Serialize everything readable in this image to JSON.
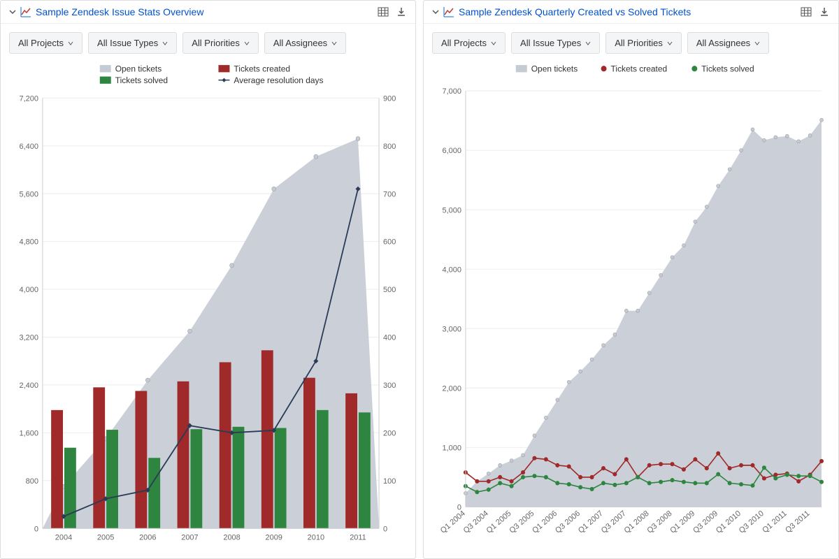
{
  "panels": {
    "left": {
      "title": "Sample Zendesk Issue Stats Overview",
      "filters": [
        "All Projects",
        "All Issue Types",
        "All Priorities",
        "All Assignees"
      ],
      "legend": {
        "open": "Open tickets",
        "created": "Tickets created",
        "solved": "Tickets solved",
        "avg": "Average resolution days"
      }
    },
    "right": {
      "title": "Sample Zendesk Quarterly Created vs Solved Tickets",
      "filters": [
        "All Projects",
        "All Issue Types",
        "All Priorities",
        "All Assignees"
      ],
      "legend": {
        "open": "Open tickets",
        "created": "Tickets created",
        "solved": "Tickets solved"
      }
    }
  },
  "colors": {
    "open_area": "#c5cbd4",
    "created_bar": "#a02929",
    "solved_bar": "#2e8540",
    "avg_line": "#2a3b57",
    "grid": "#eeeeee",
    "axis": "#cccccc",
    "text": "#555555",
    "title": "#0052cc"
  },
  "chart_data": [
    {
      "id": "annual_overview",
      "type": "combo",
      "title": "Sample Zendesk Issue Stats Overview",
      "categories": [
        "2004",
        "2005",
        "2006",
        "2007",
        "2008",
        "2009",
        "2010",
        "2011"
      ],
      "y_left": {
        "label": "",
        "min": 0,
        "max": 7200,
        "ticks": [
          0,
          800,
          1600,
          2400,
          3200,
          4000,
          4800,
          5600,
          6400,
          7200
        ]
      },
      "y_right": {
        "label": "",
        "min": 0,
        "max": 900,
        "ticks": [
          0,
          100,
          200,
          300,
          400,
          500,
          600,
          700,
          800,
          900
        ]
      },
      "series": [
        {
          "name": "Open tickets",
          "kind": "area",
          "axis": "left",
          "color": "#c5cbd4",
          "values": [
            700,
            1500,
            2480,
            3300,
            4400,
            5680,
            6220,
            6520
          ]
        },
        {
          "name": "Tickets created",
          "kind": "bar",
          "axis": "left",
          "color": "#a02929",
          "values": [
            1980,
            2360,
            2300,
            2460,
            2780,
            2980,
            2520,
            2260
          ]
        },
        {
          "name": "Tickets solved",
          "kind": "bar",
          "axis": "left",
          "color": "#2e8540",
          "values": [
            1350,
            1650,
            1180,
            1660,
            1700,
            1680,
            1980,
            1940
          ]
        },
        {
          "name": "Average resolution days",
          "kind": "line",
          "axis": "right",
          "color": "#2a3b57",
          "values": [
            25,
            62,
            80,
            215,
            200,
            205,
            350,
            710
          ]
        }
      ]
    },
    {
      "id": "quarterly",
      "type": "area_line",
      "title": "Sample Zendesk Quarterly Created vs Solved Tickets",
      "x_tick_labels": [
        "Q1 2004",
        "Q3 2004",
        "Q1 2005",
        "Q3 2005",
        "Q1 2006",
        "Q3 2006",
        "Q1 2007",
        "Q3 2007",
        "Q1 2008",
        "Q3 2008",
        "Q1 2009",
        "Q3 2009",
        "Q1 2010",
        "Q3 2010",
        "Q1 2011",
        "Q3 2011"
      ],
      "categories": [
        "Q1 2004",
        "Q2 2004",
        "Q3 2004",
        "Q4 2004",
        "Q1 2005",
        "Q2 2005",
        "Q3 2005",
        "Q4 2005",
        "Q1 2006",
        "Q2 2006",
        "Q3 2006",
        "Q4 2006",
        "Q1 2007",
        "Q2 2007",
        "Q3 2007",
        "Q4 2007",
        "Q1 2008",
        "Q2 2008",
        "Q3 2008",
        "Q4 2008",
        "Q1 2009",
        "Q2 2009",
        "Q3 2009",
        "Q4 2009",
        "Q1 2010",
        "Q2 2010",
        "Q3 2010",
        "Q4 2010",
        "Q1 2011",
        "Q2 2011",
        "Q3 2011",
        "Q4 2011"
      ],
      "y": {
        "label": "",
        "min": 0,
        "max": 7000,
        "ticks": [
          0,
          1000,
          2000,
          3000,
          4000,
          5000,
          6000,
          7000
        ]
      },
      "series": [
        {
          "name": "Open tickets",
          "kind": "area",
          "color": "#c5cbd4",
          "values": [
            230,
            430,
            560,
            700,
            780,
            870,
            1200,
            1500,
            1800,
            2100,
            2280,
            2480,
            2720,
            2900,
            3300,
            3300,
            3600,
            3900,
            4200,
            4400,
            4800,
            5050,
            5400,
            5680,
            6000,
            6350,
            6170,
            6220,
            6240,
            6150,
            6250,
            6510
          ]
        },
        {
          "name": "Tickets created",
          "kind": "line",
          "color": "#a02929",
          "values": [
            580,
            430,
            430,
            500,
            430,
            580,
            820,
            800,
            700,
            680,
            500,
            500,
            650,
            550,
            800,
            500,
            700,
            720,
            720,
            630,
            800,
            650,
            900,
            650,
            700,
            700,
            480,
            540,
            560,
            430,
            540,
            770
          ]
        },
        {
          "name": "Tickets solved",
          "kind": "line",
          "color": "#2e8540",
          "values": [
            350,
            250,
            290,
            400,
            350,
            500,
            520,
            500,
            400,
            380,
            330,
            300,
            400,
            370,
            400,
            500,
            400,
            420,
            450,
            420,
            400,
            400,
            550,
            400,
            380,
            360,
            660,
            480,
            540,
            520,
            520,
            420
          ]
        }
      ]
    }
  ]
}
